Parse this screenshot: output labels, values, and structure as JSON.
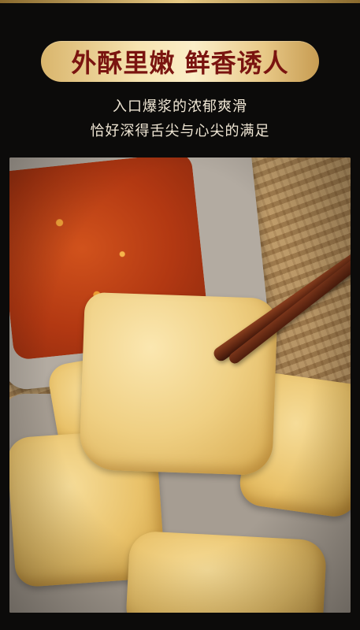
{
  "banner": {
    "title": "外酥里嫩 鲜香诱人"
  },
  "subtitle": {
    "line1": "入口爆浆的浓郁爽滑",
    "line2": "恰好深得舌尖与心尖的满足"
  }
}
